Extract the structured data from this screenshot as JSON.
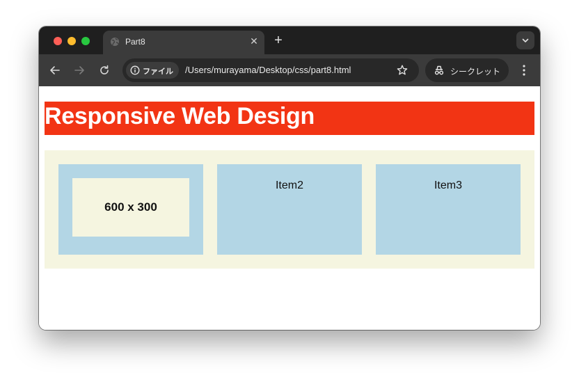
{
  "browser": {
    "tab_title": "Part8",
    "tab_close_icon": "close-icon",
    "new_tab_icon": "plus-icon",
    "site_info_label": "ファイル",
    "url": "/Users/murayama/Desktop/css/part8.html",
    "incognito_label": "シークレット"
  },
  "page": {
    "header_title": "Responsive Web Design",
    "items": [
      {
        "placeholder_text": "600 x 300"
      },
      {
        "label": "Item2"
      },
      {
        "label": "Item3"
      }
    ]
  },
  "colors": {
    "header_bg": "#f23414",
    "container_bg": "#f5f5e0",
    "item_bg": "#b3d6e5",
    "chrome_dark": "#1f1f1f",
    "chrome_toolbar": "#3b3b3b"
  }
}
